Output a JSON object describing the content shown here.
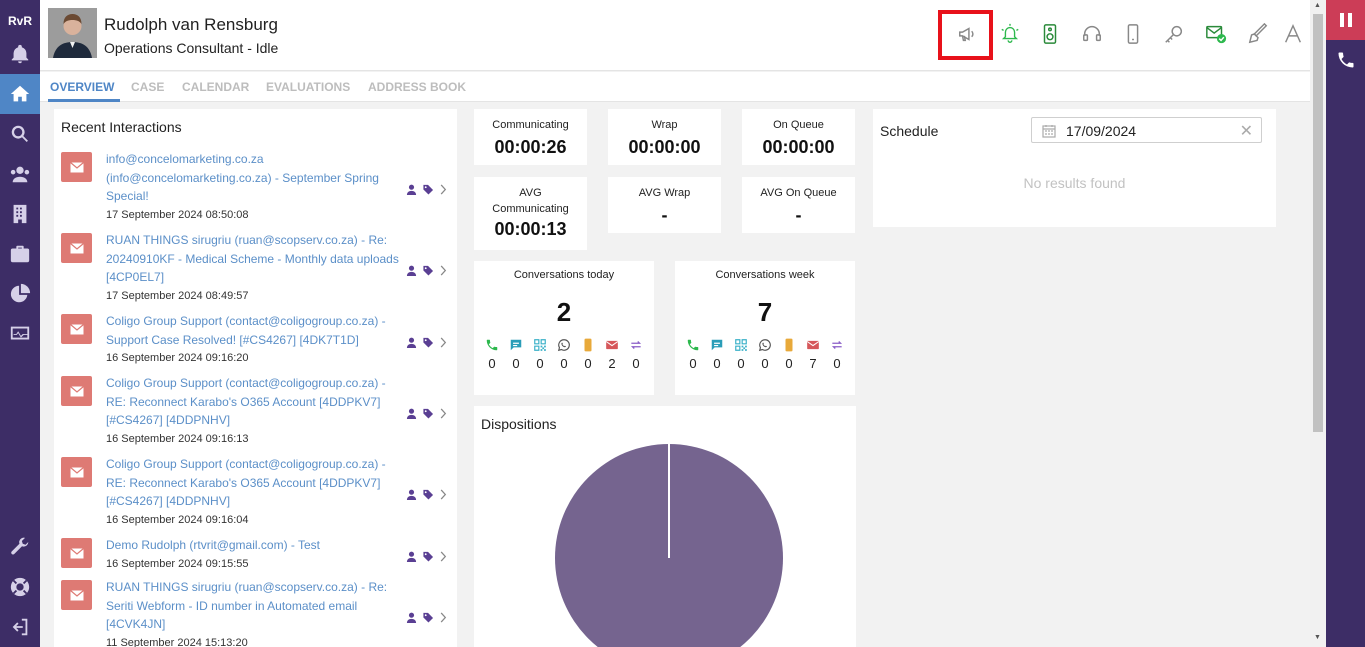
{
  "left_nav": {
    "logo": "RvR",
    "items": [
      {
        "icon": "bell-icon"
      },
      {
        "icon": "home-icon",
        "active": true
      },
      {
        "icon": "search-icon"
      },
      {
        "icon": "users-icon"
      },
      {
        "icon": "building-icon"
      },
      {
        "icon": "briefcase-icon"
      },
      {
        "icon": "pie-chart-icon"
      },
      {
        "icon": "monitor-icon"
      }
    ],
    "bottom_items": [
      {
        "icon": "wrench-icon"
      },
      {
        "icon": "lifebuoy-icon"
      },
      {
        "icon": "logout-icon"
      }
    ]
  },
  "header": {
    "name": "Rudolph van Rensburg",
    "status": "Operations Consultant - Idle",
    "icons": [
      "megaphone-icon",
      "alarm-bell-icon",
      "speaker-icon",
      "headset-icon",
      "mobile-icon",
      "key-icon",
      "email-check-icon",
      "brush-icon",
      "font-icon"
    ]
  },
  "tabs": [
    "OVERVIEW",
    "CASE",
    "CALENDAR",
    "EVALUATIONS",
    "ADDRESS BOOK"
  ],
  "recent": {
    "title": "Recent Interactions",
    "items": [
      {
        "text": "info@concelomarketing.co.za (info@concelomarketing.co.za) - September Spring Special!",
        "date": "17 September 2024 08:50:08"
      },
      {
        "text": "RUAN THINGS sirugriu (ruan@scopserv.co.za) - Re: 20240910KF - Medical Scheme - Monthly data uploads [4CP0EL7]",
        "date": "17 September 2024 08:49:57"
      },
      {
        "text": "Coligo Group Support (contact@coligogroup.co.za) - Support Case Resolved! [#CS4267] [4DK7T1D]",
        "date": "16 September 2024 09:16:20"
      },
      {
        "text": "Coligo Group Support (contact@coligogroup.co.za) - RE: Reconnect Karabo's O365 Account [4DDPKV7] [#CS4267] [4DDPNHV]",
        "date": "16 September 2024 09:16:13"
      },
      {
        "text": "Coligo Group Support (contact@coligogroup.co.za) - RE: Reconnect Karabo's O365 Account [4DDPKV7] [#CS4267] [4DDPNHV]",
        "date": "16 September 2024 09:16:04"
      },
      {
        "text": "Demo Rudolph (rtvrit@gmail.com) - Test",
        "date": "16 September 2024 09:15:55"
      },
      {
        "text": "RUAN THINGS sirugriu (ruan@scopserv.co.za) - Re: Seriti Webform - ID number in Automated email [4CVK4JN]",
        "date": "11 September 2024 15:13:20"
      }
    ]
  },
  "stats": {
    "communicating": {
      "label": "Communicating",
      "value": "00:00:26"
    },
    "wrap": {
      "label": "Wrap",
      "value": "00:00:00"
    },
    "on_queue": {
      "label": "On Queue",
      "value": "00:00:00"
    },
    "avg_communicating": {
      "label": "AVG Communicating",
      "value": "00:00:13"
    },
    "avg_wrap": {
      "label": "AVG Wrap",
      "value": "-"
    },
    "avg_on_queue": {
      "label": "AVG On Queue",
      "value": "-"
    }
  },
  "conversations": {
    "today": {
      "label": "Conversations today",
      "total": "2",
      "counts": [
        "0",
        "0",
        "0",
        "0",
        "0",
        "2",
        "0"
      ]
    },
    "week": {
      "label": "Conversations week",
      "total": "7",
      "counts": [
        "0",
        "0",
        "0",
        "0",
        "0",
        "7",
        "0"
      ]
    },
    "channel_icons": [
      "phone-icon",
      "chat-icon",
      "qr-icon",
      "whatsapp-icon",
      "sms-icon",
      "email-icon",
      "transfer-icon"
    ]
  },
  "schedule": {
    "title": "Schedule",
    "date": "17/09/2024",
    "empty_text": "No results found"
  },
  "dispositions": {
    "title": "Dispositions"
  },
  "colors": {
    "nav_bg": "#3d2d66",
    "accent": "#4f86c6",
    "email_badge": "#de7a74",
    "pie": "#75648f",
    "pause": "#cc3d57"
  }
}
